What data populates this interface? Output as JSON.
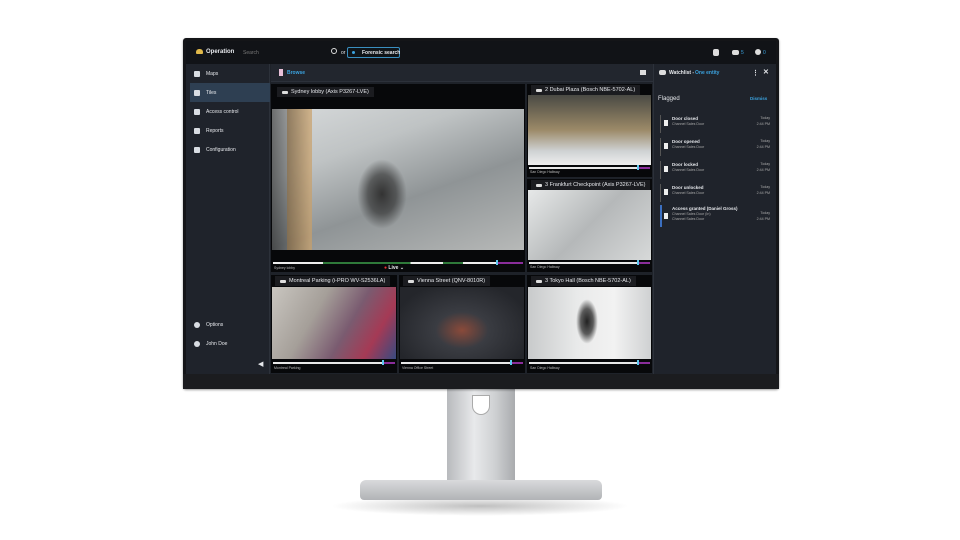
{
  "app": {
    "title": "Operation",
    "search_placeholder": "Search",
    "or": "or",
    "forensic": "Forensic search",
    "counts": {
      "alarms": "5",
      "users": "0"
    }
  },
  "sidebar": {
    "items": [
      {
        "label": "Maps"
      },
      {
        "label": "Tiles"
      },
      {
        "label": "Access control"
      },
      {
        "label": "Reports"
      },
      {
        "label": "Configuration"
      }
    ],
    "options": "Options",
    "user": "John Doe"
  },
  "browse": {
    "label": "Browse"
  },
  "tiles": [
    {
      "title": "Sydney lobby (Axis P3267-LVE)",
      "footer": "Sydney lobby",
      "live": "Live"
    },
    {
      "title": "2 Dubai Plaza (Bosch NBE-5702-AL)",
      "footer": "San Diego Hallway"
    },
    {
      "title": "3 Frankfurt Checkpoint (Axis P3267-LVE)",
      "footer": "San Diego Hallway"
    },
    {
      "title": "Montreal Parking (i-PRO WV-S2536LA)",
      "footer": "Montreal Parking"
    },
    {
      "title": "Vienna Street (QNV-8010R)",
      "footer": "Vienna Office Street"
    },
    {
      "title": "3 Tokyo Hall (Bosch NBE-5702-AL)",
      "footer": "San Diego Hallway"
    }
  ],
  "watchlist": {
    "title": "Watchlist -",
    "entity": "One entity",
    "section": "Flagged",
    "dismiss": "Dismiss",
    "events": [
      {
        "title": "Door closed",
        "sub": "Channel Sales Door",
        "day": "Today",
        "time": "2:44 PM"
      },
      {
        "title": "Door opened",
        "sub": "Channel Sales Door",
        "day": "Today",
        "time": "2:44 PM"
      },
      {
        "title": "Door locked",
        "sub": "Channel Sales Door",
        "day": "Today",
        "time": "2:44 PM"
      },
      {
        "title": "Door unlocked",
        "sub": "Channel Sales Door",
        "day": "Today",
        "time": "2:44 PM"
      },
      {
        "title": "Access granted (Daniel Gross)",
        "sub": "Channel Sales Door (In)",
        "sub2": "Channel Sales Door",
        "day": "Today",
        "time": "2:44 PM"
      }
    ]
  },
  "colors": {
    "accent": "#3ba3e0",
    "active": "#2e3f52",
    "panel": "#1f232b"
  }
}
